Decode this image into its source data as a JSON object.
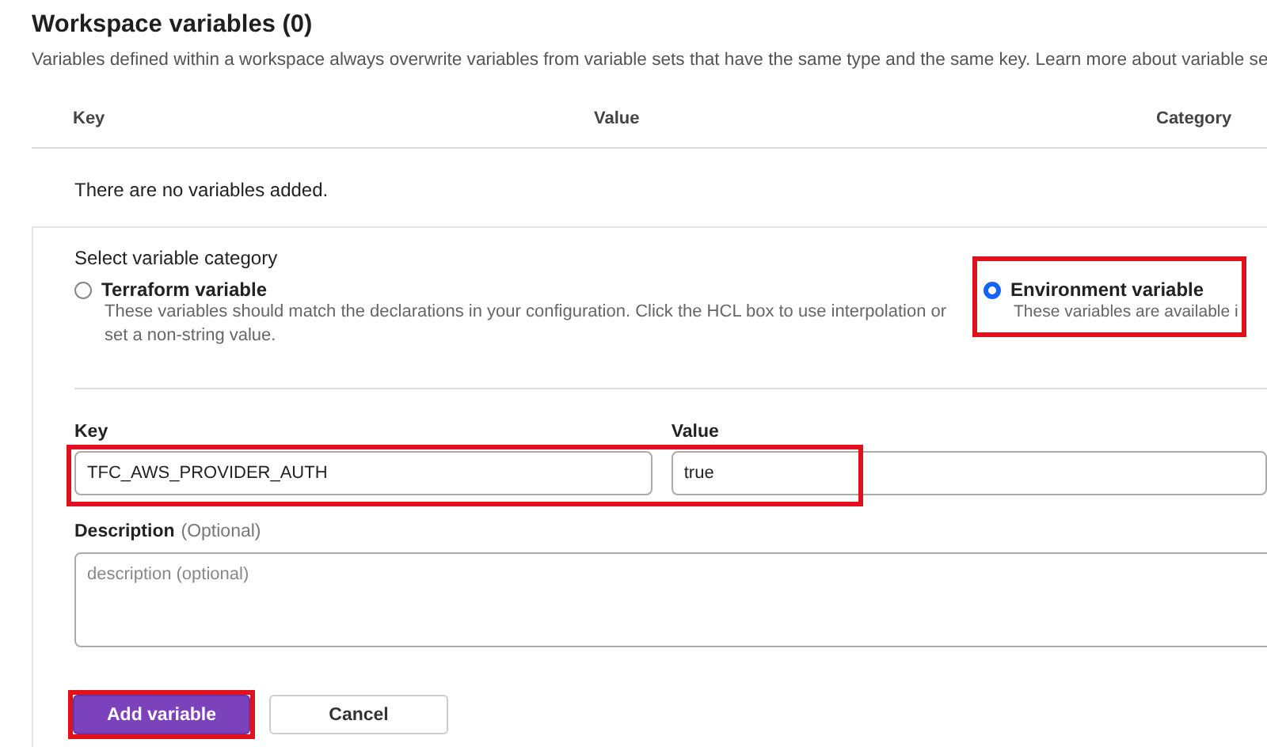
{
  "title": "Workspace variables (0)",
  "description": "Variables defined within a workspace always overwrite variables from variable sets that have the same type and the same key. Learn more about variable se",
  "table": {
    "columns": [
      "Key",
      "Value",
      "Category"
    ],
    "empty_message": "There are no variables added."
  },
  "form": {
    "category_label": "Select variable category",
    "categories": [
      {
        "label": "Terraform variable",
        "hint": "These variables should match the declarations in your configuration. Click the HCL box to use interpolation or set a non-string value.",
        "selected": false,
        "highlighted": false
      },
      {
        "label": "Environment variable",
        "hint": "These variables are available i",
        "selected": true,
        "highlighted": true
      }
    ],
    "key_field": {
      "label": "Key",
      "value": "TFC_AWS_PROVIDER_AUTH"
    },
    "value_field": {
      "label": "Value",
      "value": "true"
    },
    "fields_highlighted": true,
    "description_field": {
      "label": "Description",
      "optional": "(Optional)",
      "placeholder": "description (optional)"
    },
    "buttons": [
      {
        "label": "Add variable",
        "kind": "primary",
        "highlighted": true
      },
      {
        "label": "Cancel",
        "kind": "secondary",
        "highlighted": false
      }
    ]
  }
}
